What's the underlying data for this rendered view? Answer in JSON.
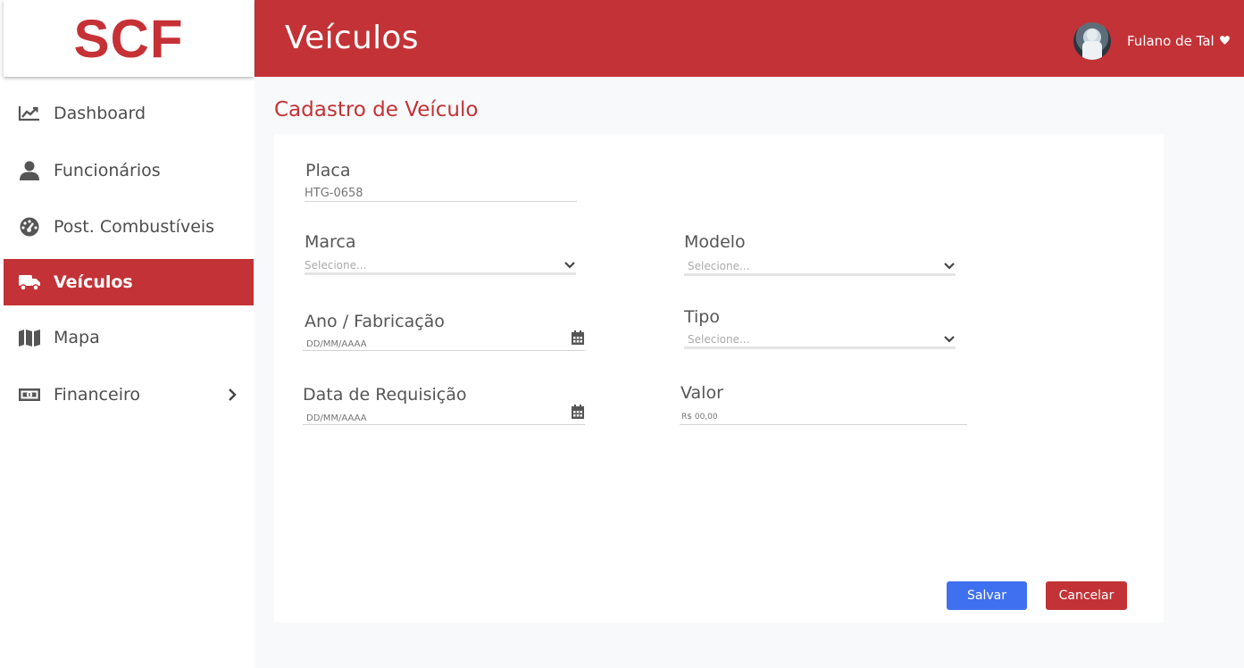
{
  "logo": {
    "text": "SCF"
  },
  "header": {
    "title": "Veículos",
    "user_name": "Fulano de Tal"
  },
  "sidebar": {
    "items": [
      {
        "label": "Dashboard",
        "icon": "chart-line-icon"
      },
      {
        "label": "Funcionários",
        "icon": "user-icon"
      },
      {
        "label": "Post. Combustíveis",
        "icon": "gauge-icon"
      },
      {
        "label": "Veículos",
        "icon": "truck-icon",
        "active": true
      },
      {
        "label": "Mapa",
        "icon": "map-icon"
      },
      {
        "label": "Financeiro",
        "icon": "money-bill-icon",
        "has_submenu": true
      }
    ]
  },
  "main": {
    "title": "Cadastro de Veículo",
    "form": {
      "placa": {
        "label": "Placa",
        "placeholder": "HTG-0658"
      },
      "marca": {
        "label": "Marca",
        "selected": "Selecione..."
      },
      "modelo": {
        "label": "Modelo",
        "selected": "Selecione..."
      },
      "ano": {
        "label": "Ano / Fabricação",
        "placeholder": "DD/MM/AAAA"
      },
      "tipo": {
        "label": "Tipo",
        "selected": "Selecione..."
      },
      "data_requisicao": {
        "label": "Data de Requisição",
        "placeholder": "DD/MM/AAAA"
      },
      "valor": {
        "label": "Valor",
        "placeholder": "R$ 00,00"
      }
    },
    "buttons": {
      "save": "Salvar",
      "cancel": "Cancelar"
    }
  },
  "colors": {
    "brand_red": "#c33236",
    "primary_blue": "#3f70ef"
  }
}
